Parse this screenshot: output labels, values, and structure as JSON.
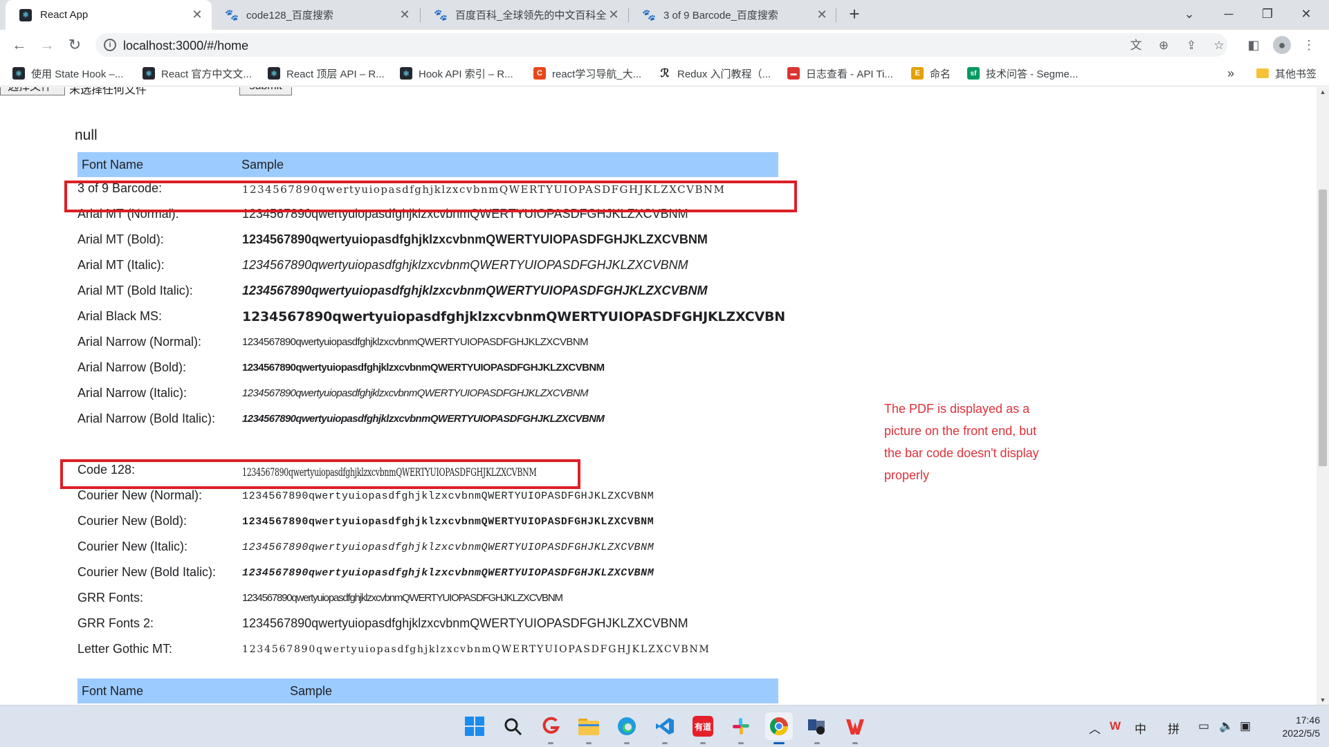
{
  "browser": {
    "tabs": [
      {
        "title": "React App",
        "favicon": "react-icon",
        "active": true
      },
      {
        "title": "code128_百度搜索",
        "favicon": "baidu-paw-icon"
      },
      {
        "title": "百度百科_全球领先的中文百科全",
        "favicon": "baidu-paw-icon"
      },
      {
        "title": "3 of 9 Barcode_百度搜索",
        "favicon": "baidu-paw-icon"
      }
    ],
    "new_tab": "+",
    "url": "localhost:3000/#/home",
    "bookmarks": [
      {
        "label": "使用 State Hook –...",
        "icon": "react-icon"
      },
      {
        "label": "React 官方中文文...",
        "icon": "react-icon"
      },
      {
        "label": "React 顶层 API – R...",
        "icon": "react-icon"
      },
      {
        "label": "Hook API 索引 – R...",
        "icon": "react-icon"
      },
      {
        "label": "react学习导航_大...",
        "icon": "c-icon"
      },
      {
        "label": "Redux 入门教程（...",
        "icon": "feather-icon"
      },
      {
        "label": "日志查看 - API Ti...",
        "icon": "log-icon"
      },
      {
        "label": "命名",
        "icon": "e-icon"
      },
      {
        "label": "技术问答 - Segme...",
        "icon": "sf-icon"
      }
    ],
    "bookmarks_overflow": "»",
    "other_bookmarks": "其他书签"
  },
  "page": {
    "file_button": "选择文件",
    "file_status": "未选择任何文件",
    "submit": "submit",
    "null_text": "null",
    "header": {
      "col1": "Font Name",
      "col2": "Sample"
    },
    "rows_a": [
      {
        "name": "3 of 9 Barcode:",
        "sample": "1234567890qwertyuiopasdfghjklzxcvbnmQWERTYUIOPASDFGHJKLZXCVBNM"
      },
      {
        "name": "Arial MT (Normal):",
        "sample": "1234567890qwertyuiopasdfghjklzxcvbnmQWERTYUIOPASDFGHJKLZXCVBNM"
      },
      {
        "name": "Arial MT (Bold):",
        "sample": "1234567890qwertyuiopasdfghjklzxcvbnmQWERTYUIOPASDFGHJKLZXCVBNM"
      },
      {
        "name": "Arial MT (Italic):",
        "sample": "1234567890qwertyuiopasdfghjklzxcvbnmQWERTYUIOPASDFGHJKLZXCVBNM"
      },
      {
        "name": "Arial MT (Bold Italic):",
        "sample": "1234567890qwertyuiopasdfghjklzxcvbnmQWERTYUIOPASDFGHJKLZXCVBNM"
      },
      {
        "name": "Arial Black MS:",
        "sample": "1234567890qwertyuiopasdfghjklzxcvbnmQWERTYUIOPASDFGHJKLZXCVBN"
      },
      {
        "name": "Arial Narrow (Normal):",
        "sample": "1234567890qwertyuiopasdfghjklzxcvbnmQWERTYUIOPASDFGHJKLZXCVBNM"
      },
      {
        "name": "Arial Narrow (Bold):",
        "sample": "1234567890qwertyuiopasdfghjklzxcvbnmQWERTYUIOPASDFGHJKLZXCVBNM"
      },
      {
        "name": "Arial Narrow (Italic):",
        "sample": "1234567890qwertyuiopasdfghjklzxcvbnmQWERTYUIOPASDFGHJKLZXCVBNM"
      },
      {
        "name": "Arial Narrow (Bold Italic):",
        "sample": "1234567890qwertyuiopasdfghjklzxcvbnmQWERTYUIOPASDFGHJKLZXCVBNM"
      }
    ],
    "rows_b": [
      {
        "name": "Code 128:",
        "sample": "1234567890qwertyuiopasdfghjklzxcvbnmQWERTYUIOPASDFGHJKLZXCVBNM"
      },
      {
        "name": "Courier New (Normal):",
        "sample": "1234567890qwertyuiopasdfghjklzxcvbnmQWERTYUIOPASDFGHJKLZXCVBNM"
      },
      {
        "name": "Courier New (Bold):",
        "sample": "1234567890qwertyuiopasdfghjklzxcvbnmQWERTYUIOPASDFGHJKLZXCVBNM"
      },
      {
        "name": "Courier New (Italic):",
        "sample": "1234567890qwertyuiopasdfghjklzxcvbnmQWERTYUIOPASDFGHJKLZXCVBNM"
      },
      {
        "name": "Courier New (Bold Italic):",
        "sample": "1234567890qwertyuiopasdfghjklzxcvbnmQWERTYUIOPASDFGHJKLZXCVBNM"
      },
      {
        "name": "GRR Fonts:",
        "sample": "1234567890qwertyuiopasdfghjklzxcvbnmQWERTYUIOPASDFGHJKLZXCVBNM"
      },
      {
        "name": "GRR Fonts 2:",
        "sample": "1234567890qwertyuiopasdfghjklzxcvbnmQWERTYUIOPASDFGHJKLZXCVBNM"
      },
      {
        "name": "Letter Gothic MT:",
        "sample": "1234567890qwertyuiopasdfghjklzxcvbnmQWERTYUIOPASDFGHJKLZXCVBNM"
      }
    ],
    "header2": {
      "col1": "Font Name",
      "col2": "Sample"
    },
    "annotation": "The PDF is displayed as a picture on the front end, but the bar code doesn't display properly"
  },
  "taskbar": {
    "apps": [
      "windows-start-icon",
      "search-icon",
      "git-icon",
      "file-explorer-icon",
      "edge-icon",
      "vscode-icon",
      "youdao-icon",
      "slack-icon",
      "chrome-icon",
      "network-app-icon",
      "wps-icon"
    ],
    "youdao_label": "有道",
    "tray": {
      "ime_lang": "中",
      "ime_mode": "拼"
    },
    "time": "17:46",
    "date": "2022/5/5"
  },
  "colors": {
    "annotation_red": "#dc1f26",
    "table_header": "#9ccbff",
    "taskbar": "#dbe3ee"
  }
}
